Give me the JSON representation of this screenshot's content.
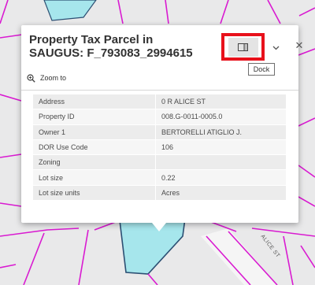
{
  "popup": {
    "title": "Property Tax Parcel in SAUGUS: F_793083_2994615",
    "dock_tooltip": "Dock",
    "zoom_to_label": "Zoom to",
    "icons": {
      "dock": "dock-icon",
      "collapse": "chevron-down-icon",
      "close": "close-icon",
      "zoom": "zoom-in-icon"
    },
    "attributes": [
      {
        "label": "Address",
        "value": "0 R ALICE ST"
      },
      {
        "label": "Property ID",
        "value": "008.G-0011-0005.0"
      },
      {
        "label": "Owner 1",
        "value": "BERTORELLI ATIGLIO J."
      },
      {
        "label": "DOR Use Code",
        "value": "106"
      },
      {
        "label": "Zoning",
        "value": ""
      },
      {
        "label": "Lot size",
        "value": "0.22"
      },
      {
        "label": "Lot size units",
        "value": "Acres"
      }
    ]
  },
  "map": {
    "street_label": "ALICE ST",
    "colors": {
      "parcel_line": "#d91ad1",
      "selected_parcel_fill": "#a6e6ec",
      "selected_parcel_outline": "#2c4f73",
      "background": "#e9e9ea",
      "highlight": "#e8111b"
    }
  }
}
